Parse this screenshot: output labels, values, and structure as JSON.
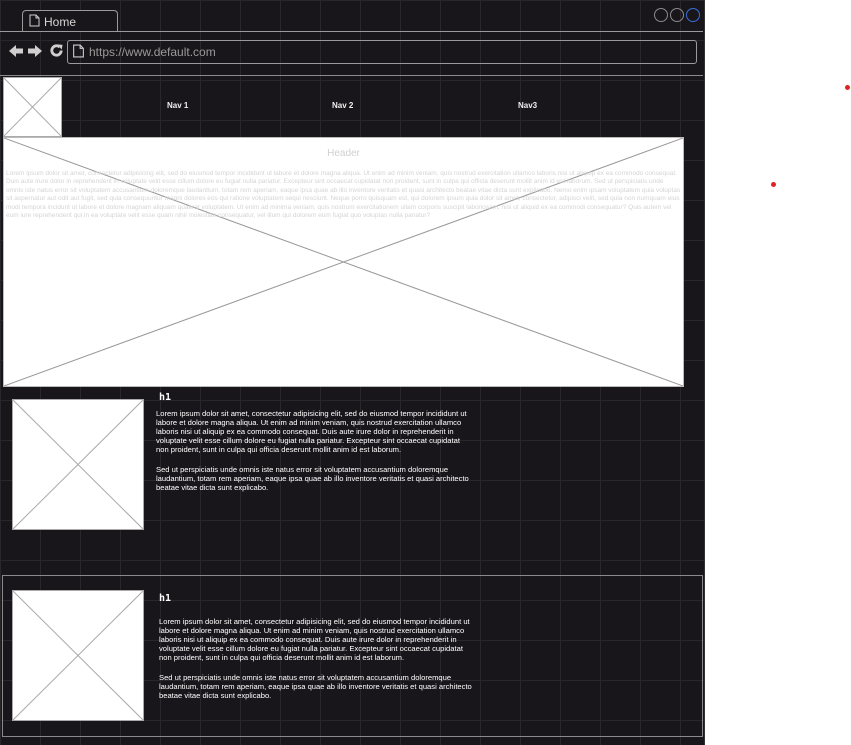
{
  "browser": {
    "tab_label": "Home",
    "url": "https://www.default.com"
  },
  "nav": {
    "items": [
      "Nav 1",
      "Nav 2",
      "Nav3"
    ]
  },
  "hero": {
    "title": "Header",
    "text": "Lorem ipsum dolor sit amet, consectetur adipisicing elit, sed do eiusmod tempor incididunt ut labore et dolore magna aliqua. Ut enim ad minim veniam, quis nostrud exercitation ullamco laboris nisi ut aliquip ex ea commodo consequat. Duis aute irure dolor in reprehenderit in voluptate velit esse cillum dolore eu fugiat nulla pariatur. Excepteur sint occaecat cupidatat non proident, sunt in culpa qui officia deserunt mollit anim id est laborum. Sed ut perspiciatis unde omnis iste natus error sit voluptatem accusantium doloremque laudantium, totam rem aperiam, eaque ipsa quae ab illo inventore veritatis et quasi architecto beatae vitae dicta sunt explicabo. Nemo enim ipsam voluptatem quia voluptas sit aspernatur aut odit aut fugit, sed quia consequuntur magni dolores eos qui ratione voluptatem sequi nesciunt. Neque porro quisquam est, qui dolorem ipsum quia dolor sit amet, consectetur, adipisci velit, sed quia non numquam eius modi tempora incidunt ut labore et dolore magnam aliquam quaerat voluptatem. Ut enim ad minima veniam, quis nostrum exercitationem ullam corporis suscipit laboriosam, nisi ut aliquid ex ea commodi consequatur? Quis autem vel eum iure reprehenderit qui in ea voluptate velit esse quam nihil molestiae consequatur, vel illum qui dolorem eum fugiat quo voluptas nulla pariatur?"
  },
  "rows": [
    {
      "heading": "h1",
      "paragraph_1": "Lorem ipsum dolor sit amet, consectetur adipisicing elit, sed do eiusmod tempor incididunt ut labore et dolore magna aliqua. Ut enim ad minim veniam, quis nostrud exercitation ullamco laboris nisi ut aliquip ex ea commodo consequat. Duis aute irure dolor in reprehenderit in voluptate velit esse cillum dolore eu fugiat nulla pariatur. Excepteur sint occaecat cupidatat non proident, sunt in culpa qui officia deserunt mollit anim id est laborum.",
      "paragraph_2": "Sed ut perspiciatis unde omnis iste natus error sit voluptatem accusantium doloremque laudantium, totam rem aperiam, eaque ipsa quae ab illo inventore veritatis et quasi architecto beatae vitae dicta sunt explicabo."
    },
    {
      "heading": "h1",
      "paragraph_1": "Lorem ipsum dolor sit amet, consectetur adipisicing elit, sed do eiusmod tempor incididunt ut labore et dolore magna aliqua. Ut enim ad minim veniam, quis nostrud exercitation ullamco laboris nisi ut aliquip ex ea commodo consequat. Duis aute irure dolor in reprehenderit in voluptate velit esse cillum dolore eu fugiat nulla pariatur. Excepteur sint occaecat cupidatat non proident, sunt in culpa qui officia deserunt mollit anim id est laborum.",
      "paragraph_2": "Sed ut perspiciatis unde omnis iste natus error sit voluptatem accusantium doloremque laudantium, totam rem aperiam, eaque ipsa quae ab illo inventore veritatis et quasi architecto beatae vitae dicta sunt explicabo."
    }
  ],
  "icons": {
    "back": "arrow-left-icon",
    "forward": "arrow-right-icon",
    "reload": "reload-icon",
    "page": "document-icon",
    "placeholder": "image-placeholder-icon"
  },
  "colors": {
    "window_bg": "#19161b",
    "marker": "#e02424",
    "window_control_active": "#3a6fd8"
  }
}
